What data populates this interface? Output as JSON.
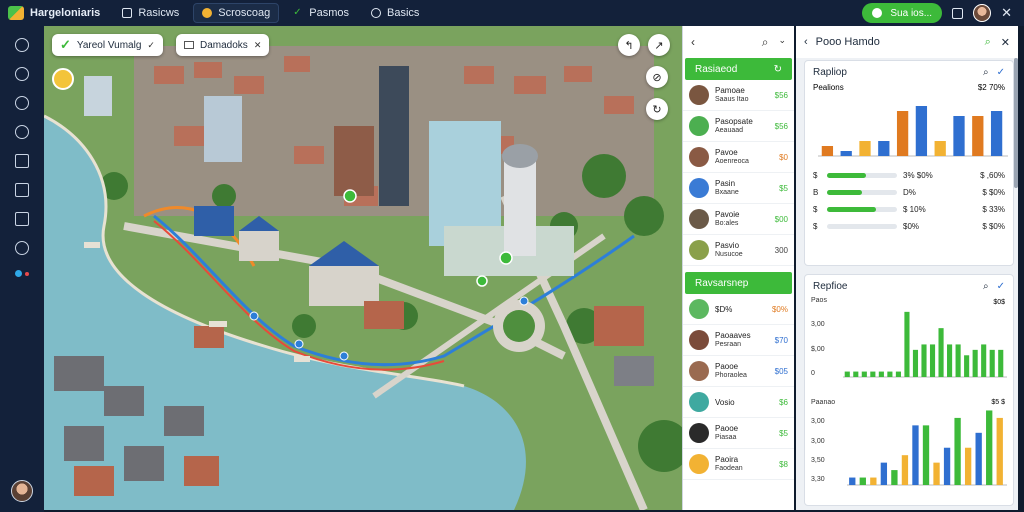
{
  "topbar": {
    "app_name": "Hargeloniaris",
    "items": [
      {
        "label": "Rasicws"
      },
      {
        "label": "Scroscoag"
      },
      {
        "label": "Pasmos"
      },
      {
        "label": "Basics"
      }
    ],
    "status_pill": "Sua ios..."
  },
  "map": {
    "layer_chip": "Yareol Vumalg",
    "filter_chip": "Damadoks"
  },
  "list_panel": {
    "header_title": "",
    "section1_title": "Rasiaeod",
    "section2_title": "Ravsarsnep",
    "rows": [
      {
        "name": "Pamoae",
        "sub": "Saaus Itao",
        "value": "$56",
        "color": "#3dba3a"
      },
      {
        "name": "Pasopsate",
        "sub": "Aeauaad",
        "value": "$56",
        "color": "#3dba3a"
      },
      {
        "name": "Pavoe",
        "sub": "Aoenreoca",
        "value": "$0",
        "color": "#e07a20"
      },
      {
        "name": "Pasin",
        "sub": "Bxaane",
        "value": "$5",
        "color": "#3dba3a"
      },
      {
        "name": "Pavoie",
        "sub": "Bo:ales",
        "value": "$00",
        "color": "#3dba3a"
      },
      {
        "name": "Pasvio",
        "sub": "Nusucoe",
        "value": "300",
        "color": "#444444"
      }
    ],
    "rows2": [
      {
        "name": "$D%",
        "sub": "",
        "value": "$0%",
        "color": "#e07a20"
      },
      {
        "name": "Paoaaves",
        "sub": "Pesraan",
        "value": "$70",
        "color": "#2f6fd0"
      },
      {
        "name": "Paooe",
        "sub": "Phoraolea",
        "value": "$05",
        "color": "#2f6fd0"
      },
      {
        "name": "Vosio",
        "sub": "",
        "value": "$6",
        "color": "#3dba3a"
      },
      {
        "name": "Paooe",
        "sub": "Piasaa",
        "value": "$5",
        "color": "#3dba3a"
      },
      {
        "name": "Paoira",
        "sub": "Faodean",
        "value": "$8",
        "color": "#3dba3a"
      }
    ]
  },
  "analytics": {
    "header_title": "Pooo Hamdo",
    "card1": {
      "title": "Rapliop",
      "chart_label": "Pealions",
      "chart_value": "$2 70%",
      "chart_data": {
        "type": "bar",
        "series": [
          {
            "values": [
              2,
              1,
              3,
              3,
              9,
              10,
              3,
              8,
              8,
              9
            ]
          }
        ],
        "ylim": [
          0,
          12
        ]
      },
      "progress": [
        {
          "label": "$",
          "value": "3% $0%",
          "right": "$ ,60%",
          "fill": 0.55
        },
        {
          "label": "B",
          "value": "D%",
          "right": "$ $0%",
          "fill": 0.5
        },
        {
          "label": "$",
          "value": "$ 10%",
          "right": "$ 33%",
          "fill": 0.7
        },
        {
          "label": "$",
          "value": "$0%",
          "right": "$ $0%",
          "fill": 0
        }
      ]
    },
    "card2": {
      "title": "Repfioe",
      "chart1": {
        "ylabels": [
          "Paos",
          "3,00",
          "$,00",
          "0"
        ],
        "right_label": "$0$",
        "chart_data": {
          "type": "bar",
          "series": [
            {
              "values": [
                1,
                1,
                1,
                1,
                1,
                1,
                1,
                12,
                5,
                6,
                6,
                9,
                6,
                6,
                4,
                5,
                6,
                5,
                5
              ]
            }
          ],
          "ylim": [
            0,
            14
          ]
        }
      },
      "chart2": {
        "ylabels": [
          "Paanao",
          "3,00",
          "3,00",
          "3,50",
          "3,30"
        ],
        "right_label": "$5 $",
        "chart_data": {
          "type": "bar",
          "series": [
            {
              "values": [
                1,
                1,
                1,
                3,
                2,
                4,
                8,
                8,
                3,
                5,
                9,
                5,
                7,
                10,
                9
              ]
            }
          ],
          "ylim": [
            0,
            11
          ]
        }
      }
    }
  }
}
